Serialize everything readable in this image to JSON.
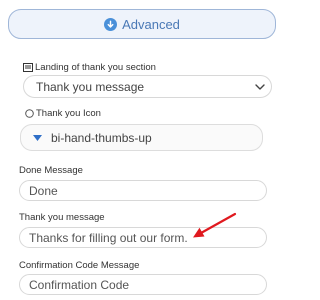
{
  "advanced": {
    "label": "Advanced",
    "icon": "arrow-down-circle-icon"
  },
  "landing": {
    "label": "Landing of thank you section",
    "icon": "list-icon",
    "selected_value": "Thank you message"
  },
  "thank_you_icon": {
    "label": "Thank you Icon",
    "radio_icon": "radio-icon",
    "value": "bi-hand-thumbs-up"
  },
  "done_message": {
    "label": "Done Message",
    "value": "Done"
  },
  "thank_you_message": {
    "label": "Thank you message",
    "placeholder": "Thanks for filling out our form."
  },
  "confirmation_code": {
    "label": "Confirmation Code Message",
    "value": "Confirmation Code"
  },
  "colors": {
    "accent": "#4a90d9",
    "annotation_arrow": "#e0191f"
  }
}
